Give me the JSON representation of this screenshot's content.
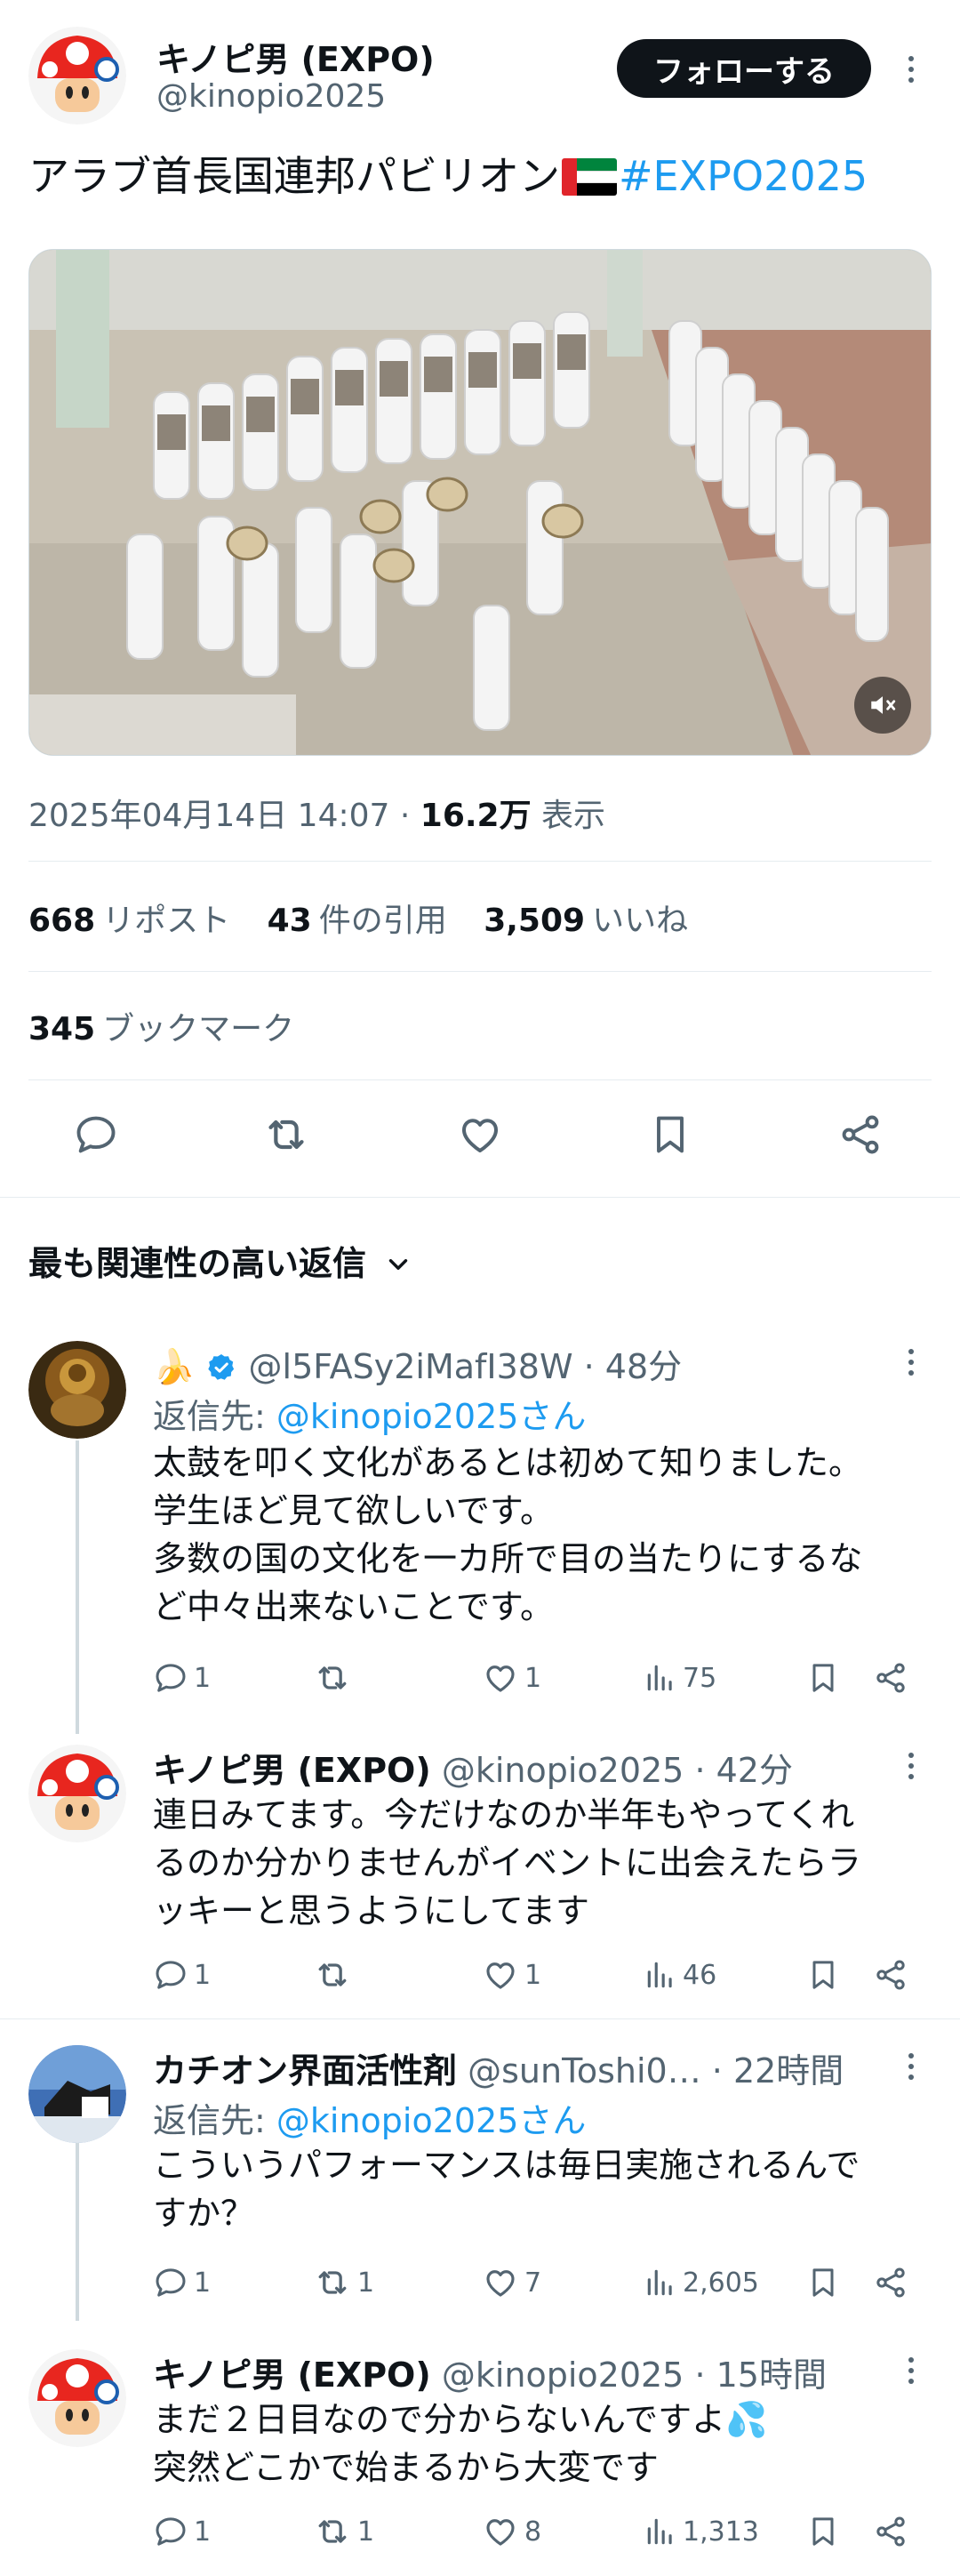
{
  "author": {
    "display_name": "キノピ男 (EXPO)",
    "handle": "@kinopio2025",
    "follow_label": "フォローする"
  },
  "tweet": {
    "text_main": "アラブ首長国連邦パビリオン",
    "hashtag": "#EXPO2025",
    "timestamp": "2025年04月14日 14:07 · ",
    "views_count": "16.2万",
    "views_label": " 表示",
    "reposts_count": "668",
    "reposts_label": "リポスト",
    "quotes_count": "43",
    "quotes_label": "件の引用",
    "likes_count": "3,509",
    "likes_label": "いいね",
    "bookmarks_count": "345",
    "bookmarks_label": "ブックマーク"
  },
  "sort": {
    "label": "最も関連性の高い返信"
  },
  "replies": [
    {
      "name": "🍌",
      "handle": "@l5FASy2iMafI38W",
      "time": "· 48分",
      "reply_prefix": "返信先: ",
      "reply_to": "@kinopio2025さん",
      "lines": [
        "太鼓を叩く文化があるとは初めて知りました。",
        "学生ほど見て欲しいです。",
        "多数の国の文化を一カ所で目の当たりにするな",
        "ど中々出来ないことです。"
      ],
      "replies": "1",
      "reposts": "",
      "likes": "1",
      "views": "75"
    },
    {
      "name": "キノピ男 (EXPO)",
      "handle": "@kinopio2025",
      "time": "· 42分",
      "lines": [
        "連日みてます。今だけなのか半年もやってくれ",
        "るのか分かりませんがイベントに出会えたらラ",
        "ッキーと思うようにしてます"
      ],
      "replies": "1",
      "reposts": "",
      "likes": "1",
      "views": "46"
    },
    {
      "name": "カチオン界面活性剤",
      "handle": "@sunToshi0…",
      "time": "· 22時間",
      "reply_prefix": "返信先: ",
      "reply_to": "@kinopio2025さん",
      "lines": [
        "こういうパフォーマンスは毎日実施されるんで",
        "すか？"
      ],
      "replies": "1",
      "reposts": "1",
      "likes": "7",
      "views": "2,605"
    },
    {
      "name": "キノピ男 (EXPO)",
      "handle": "@kinopio2025",
      "time": "· 15時間",
      "lines": [
        "まだ２日目なので分からないんですよ💦",
        "突然どこかで始まるから大変です"
      ],
      "replies": "1",
      "reposts": "1",
      "likes": "8",
      "views": "1,313"
    }
  ],
  "colors": {
    "accent": "#1d9bf0",
    "text": "#0f1419",
    "muted": "#536471",
    "border": "#e6ecf0"
  }
}
